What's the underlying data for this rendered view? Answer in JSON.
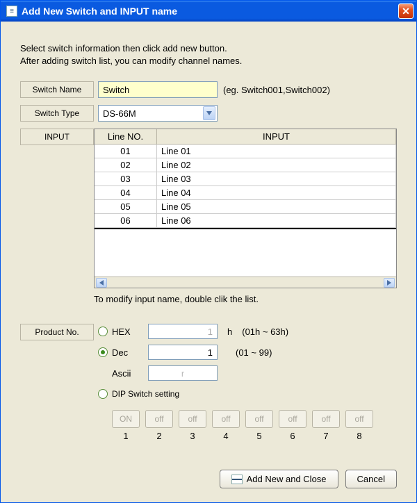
{
  "window": {
    "title": "Add New Switch and INPUT name"
  },
  "instructions": {
    "line1": "Select switch information then click add new button.",
    "line2": "After adding switch list, you can modify channel names."
  },
  "form": {
    "switch_name_label": "Switch Name",
    "switch_name_value": "Switch",
    "switch_name_hint": "(eg. Switch001,Switch002)",
    "switch_type_label": "Switch Type",
    "switch_type_value": "DS-66M",
    "input_label": "INPUT"
  },
  "table": {
    "headers": {
      "line_no": "Line NO.",
      "input": "INPUT"
    },
    "rows": [
      {
        "no": "01",
        "input": "Line 01"
      },
      {
        "no": "02",
        "input": "Line 02"
      },
      {
        "no": "03",
        "input": "Line 03"
      },
      {
        "no": "04",
        "input": "Line 04"
      },
      {
        "no": "05",
        "input": "Line 05"
      },
      {
        "no": "06",
        "input": "Line 06"
      }
    ],
    "modify_hint": "To modify input name, double clik the list."
  },
  "product": {
    "label": "Product No.",
    "hex_label": "HEX",
    "hex_value": "1",
    "hex_suffix": "h",
    "hex_range": "(01h ~ 63h)",
    "dec_label": "Dec",
    "dec_value": "1",
    "dec_range": "(01 ~ 99)",
    "ascii_label": "Ascii",
    "ascii_value": "r",
    "dip_label": "DIP Switch setting",
    "selected": "dec",
    "dip_switches": [
      {
        "state": "ON",
        "num": "1"
      },
      {
        "state": "off",
        "num": "2"
      },
      {
        "state": "off",
        "num": "3"
      },
      {
        "state": "off",
        "num": "4"
      },
      {
        "state": "off",
        "num": "5"
      },
      {
        "state": "off",
        "num": "6"
      },
      {
        "state": "off",
        "num": "7"
      },
      {
        "state": "off",
        "num": "8"
      }
    ]
  },
  "buttons": {
    "add_close": "Add New and Close",
    "cancel": "Cancel"
  }
}
